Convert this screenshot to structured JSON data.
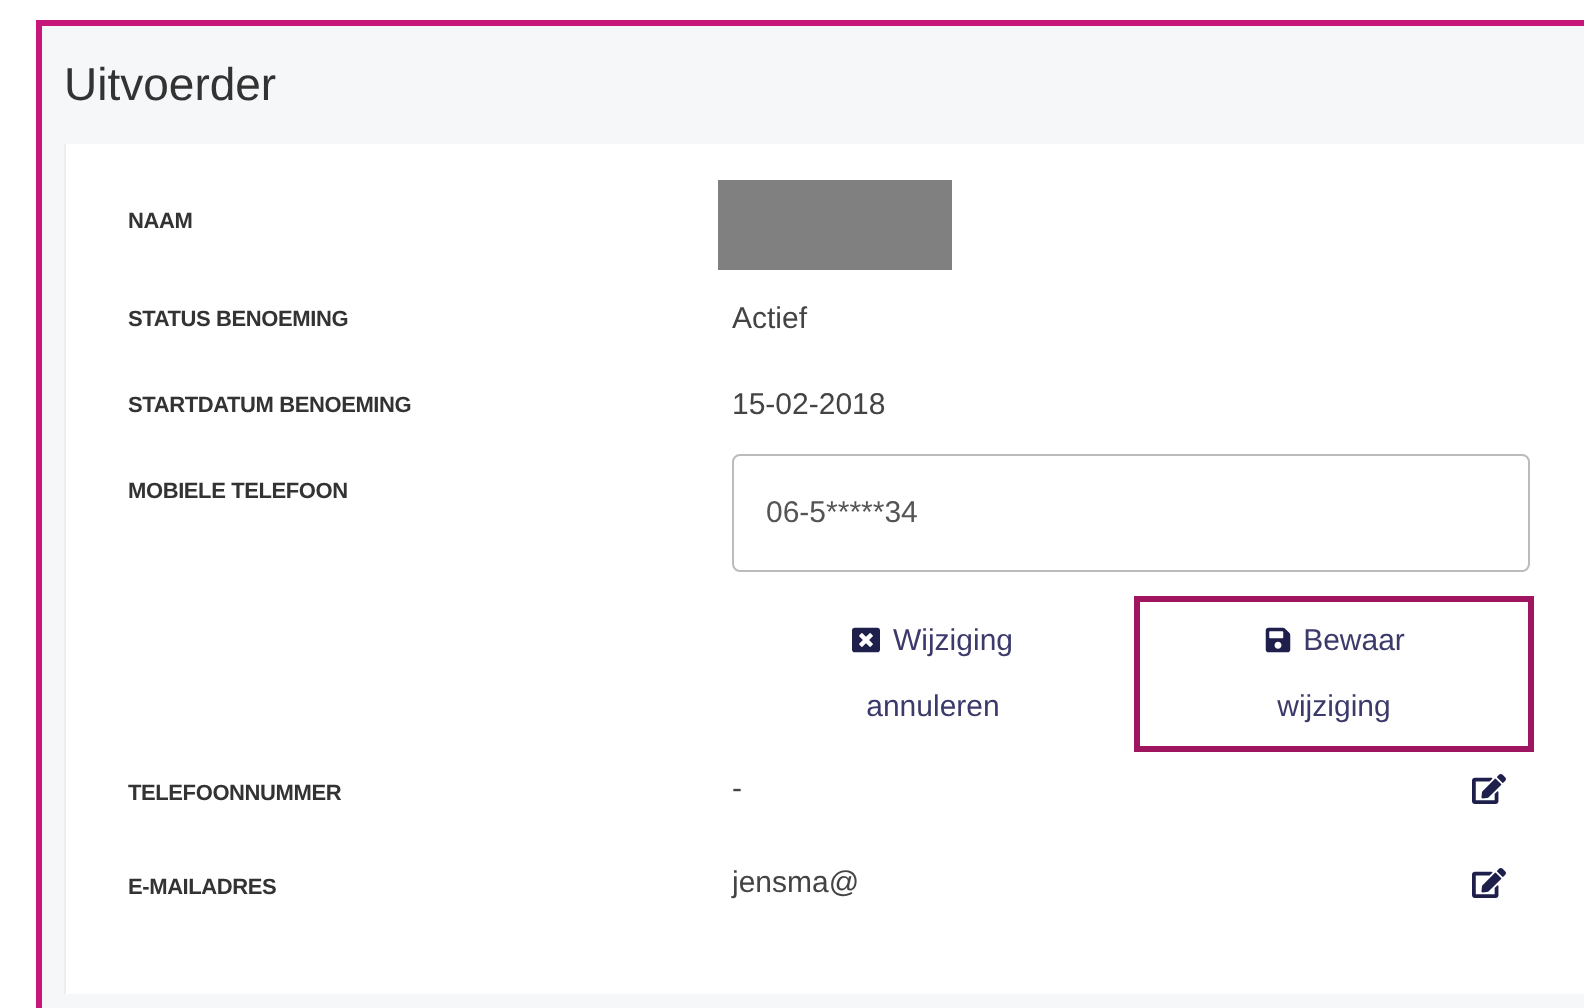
{
  "panel": {
    "title": "Uitvoerder"
  },
  "fields": [
    {
      "kind": "redacted",
      "label": "NAAM"
    },
    {
      "kind": "text",
      "label": "STATUS BENOEMING",
      "value": "Actief"
    },
    {
      "kind": "text",
      "label": "STARTDATUM BENOEMING",
      "value": "15-02-2018"
    },
    {
      "kind": "input",
      "label": "MOBIELE TELEFOON",
      "value": "06-5*****34",
      "actions": [
        {
          "kind": "cancel",
          "label": "Wijziging annuleren",
          "focused": false
        },
        {
          "kind": "save",
          "label": "Bewaar wijziging",
          "focused": true
        }
      ]
    },
    {
      "kind": "editable",
      "label": "TELEFOONNUMMER",
      "value": "-"
    },
    {
      "kind": "editable",
      "label": "E-MAILADRES",
      "value": "jensma@"
    }
  ]
}
